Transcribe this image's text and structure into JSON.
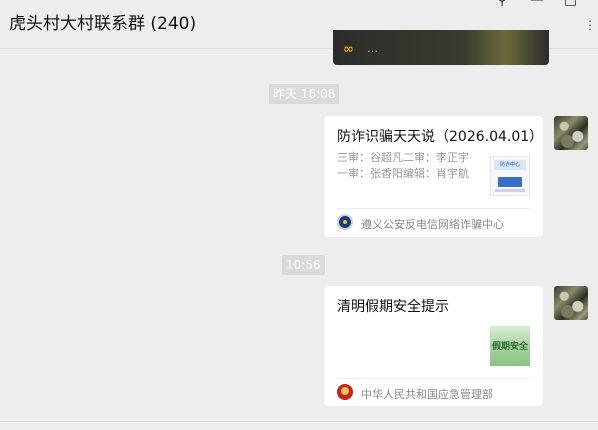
{
  "header": {
    "title": "虎头村大村联系群 (240)",
    "pin_glyph": "⚲",
    "minimize_glyph": "—",
    "maximize_glyph": "□",
    "more_glyph": "⋮"
  },
  "previous_card": {
    "text": "…"
  },
  "messages": [
    {
      "time": "昨天 16:08",
      "title": "防诈识骗天天说（2026.04.01）",
      "desc_line1": "三审：谷超凡二审：李正宇",
      "desc_line2": "一审：张香阳编辑：肖宇航",
      "thumb_text": "防诈中心",
      "source": "遵义公安反电信网络诈骗中心",
      "source_icon": "police-badge-icon"
    },
    {
      "time": "10:56",
      "title": "清明假期安全提示",
      "thumb_text": "假期安全",
      "source": "中华人民共和国应急管理部",
      "source_icon": "national-emblem-icon"
    }
  ],
  "colors": {
    "background": "#ededed",
    "card": "#ffffff",
    "time_chip": "#dadada",
    "accent_orange": "#f3a316"
  }
}
